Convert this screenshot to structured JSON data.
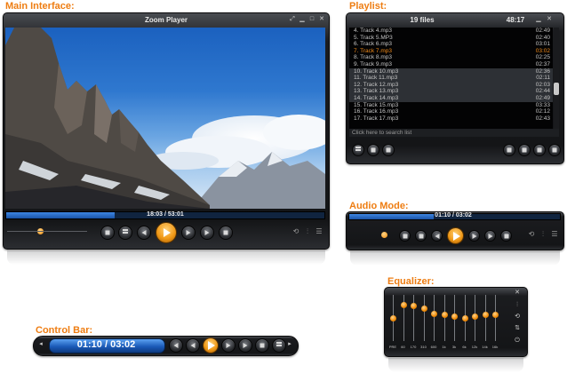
{
  "labels": {
    "main": "Main Interface:",
    "playlist": "Playlist:",
    "audio": "Audio Mode:",
    "equalizer": "Equalizer:",
    "control_bar": "Control Bar:"
  },
  "main": {
    "title": "Zoom Player",
    "time": "18:03 / 53:01",
    "progress": 0.34
  },
  "playlist": {
    "count": "19 files",
    "total_time": "48:17",
    "search_placeholder": "Click here to search list",
    "items": [
      {
        "name": "4. Track 4.mp3",
        "dur": "02:49"
      },
      {
        "name": "5. Track 5.MP3",
        "dur": "02:40"
      },
      {
        "name": "6. Track 6.mp3",
        "dur": "03:01"
      },
      {
        "name": "7. Track 7.mp3",
        "dur": "03:02"
      },
      {
        "name": "8. Track 8.mp3",
        "dur": "02:25"
      },
      {
        "name": "9. Track 9.mp3",
        "dur": "02:37"
      },
      {
        "name": "10. Track 10.mp3",
        "dur": "02:36"
      },
      {
        "name": "11. Track 11.mp3",
        "dur": "02:11"
      },
      {
        "name": "12. Track 12.mp3",
        "dur": "02:03"
      },
      {
        "name": "13. Track 13.mp3",
        "dur": "02:44"
      },
      {
        "name": "14. Track 14.mp3",
        "dur": "02:49"
      },
      {
        "name": "15. Track 15.mp3",
        "dur": "03:33"
      },
      {
        "name": "16. Track 16.mp3",
        "dur": "02:12"
      },
      {
        "name": "17. Track 17.mp3",
        "dur": "02:43"
      }
    ]
  },
  "audio": {
    "time": "01:10 / 03:02"
  },
  "control_bar": {
    "time": "01:10 / 03:02"
  },
  "equalizer": {
    "bands": [
      {
        "label": "PRE",
        "level": 0.5
      },
      {
        "label": "60",
        "level": 0.79
      },
      {
        "label": "170",
        "level": 0.77
      },
      {
        "label": "310",
        "level": 0.71
      },
      {
        "label": "600",
        "level": 0.6
      },
      {
        "label": "1k",
        "level": 0.58
      },
      {
        "label": "3k",
        "level": 0.53
      },
      {
        "label": "6k",
        "level": 0.5
      },
      {
        "label": "12k",
        "level": 0.53
      },
      {
        "label": "14k",
        "level": 0.58
      },
      {
        "label": "16k",
        "level": 0.57
      }
    ]
  },
  "colors": {
    "accent": "#ee7d12",
    "progress": "#2b6fd0",
    "current_track": "#f18b1a"
  },
  "icons": {
    "transport": [
      "stop-icon",
      "eject-icon",
      "previous-icon",
      "rewind-icon",
      "play-icon",
      "fast-forward-icon",
      "next-icon"
    ],
    "right": [
      "repeat-icon",
      "equalizer-icon",
      "playlist-icon"
    ]
  }
}
